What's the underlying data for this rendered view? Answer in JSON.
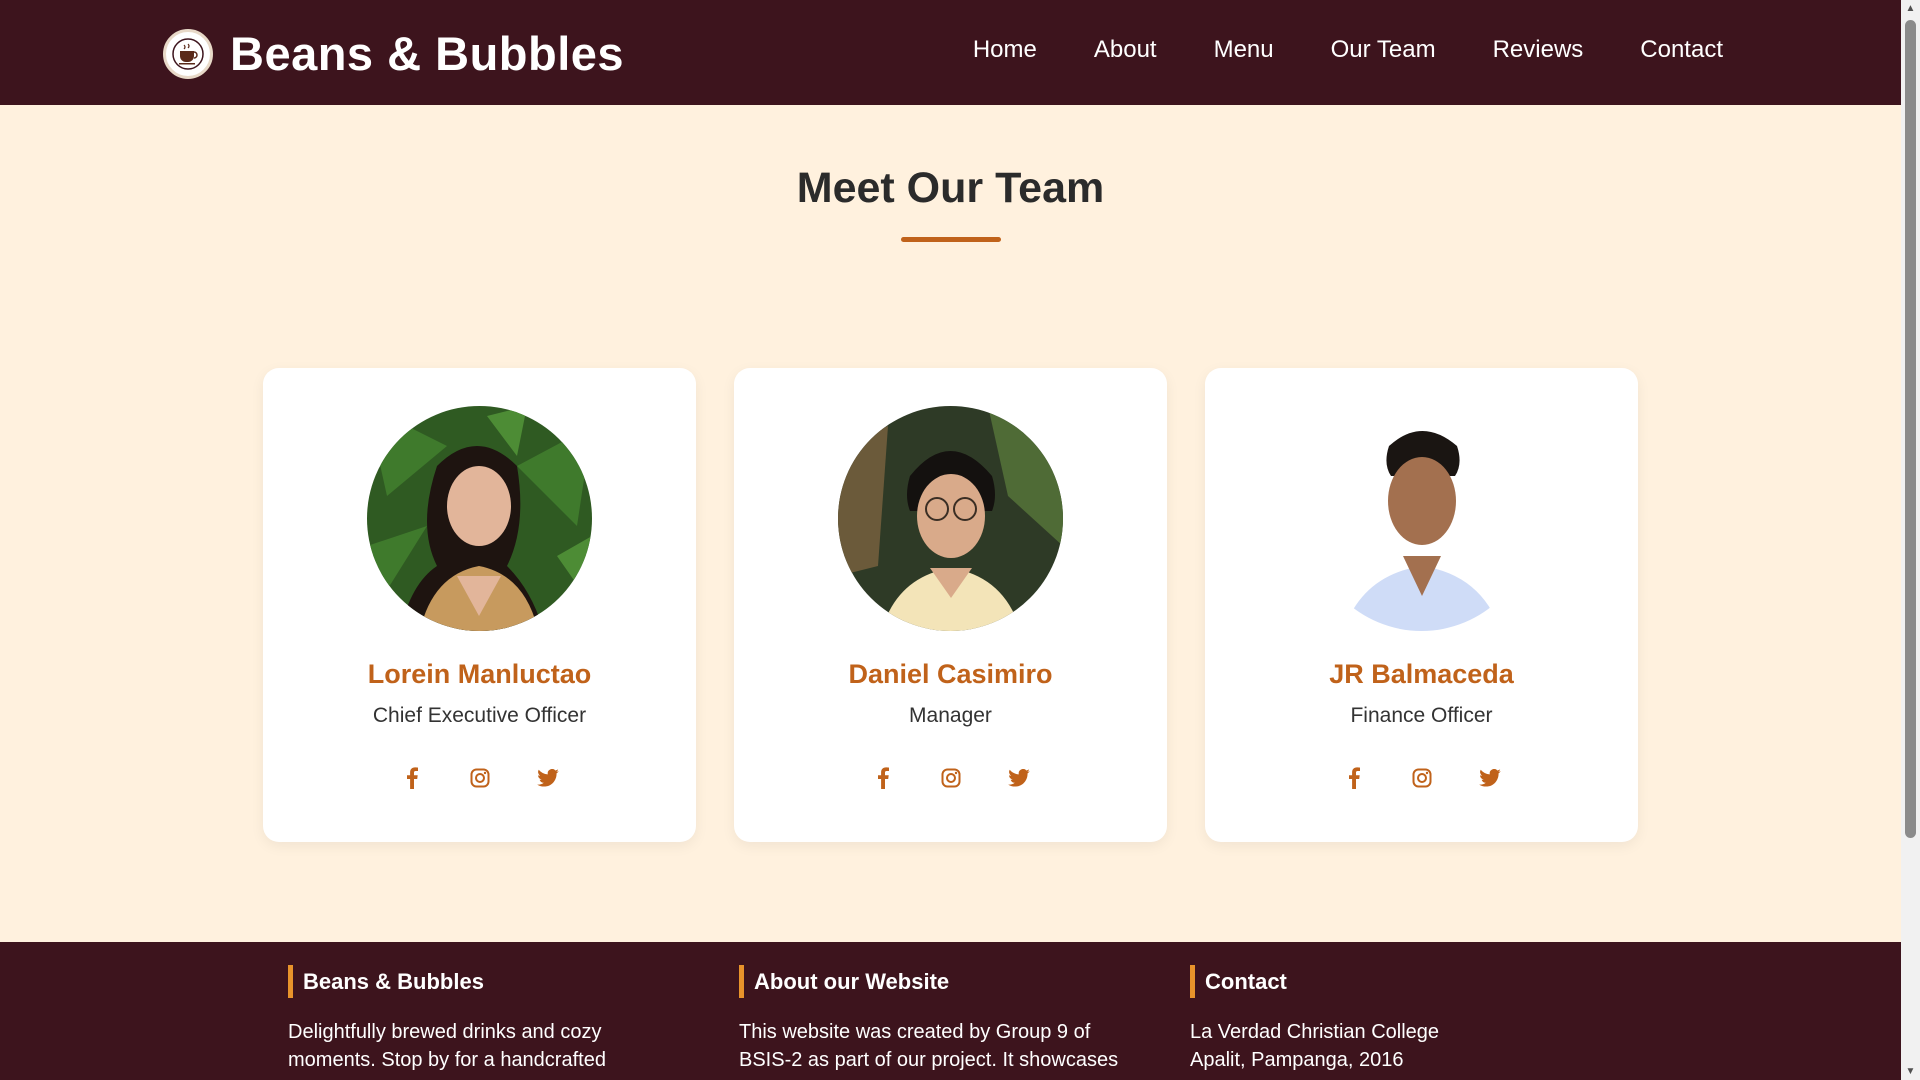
{
  "header": {
    "brand_title": "Beans & Bubbles",
    "nav": [
      "Home",
      "About",
      "Menu",
      "Our Team",
      "Reviews",
      "Contact"
    ]
  },
  "section": {
    "title": "Meet Our Team"
  },
  "team": [
    {
      "name": "Lorein Manluctao",
      "role": "Chief Executive Officer"
    },
    {
      "name": "Daniel Casimiro",
      "role": "Manager"
    },
    {
      "name": "JR Balmaceda",
      "role": "Finance Officer"
    }
  ],
  "footer": {
    "col1": {
      "title": "Beans & Bubbles",
      "lines": [
        "Delightfully brewed drinks and cozy",
        "moments. Stop by for a handcrafted"
      ]
    },
    "col2": {
      "title": "About our Website",
      "lines": [
        "This website was created by Group 9 of",
        "BSIS-2 as part of our project. It showcases"
      ]
    },
    "col3": {
      "title": "Contact",
      "lines": [
        "La Verdad Christian College",
        "Apalit, Pampanga, 2016"
      ]
    }
  },
  "colors": {
    "header_bg": "#3d141d",
    "page_bg": "#fff1de",
    "accent": "#c0621a",
    "footer_accent": "#e8932b"
  },
  "icons": [
    "coffee-cup-logo-icon",
    "facebook-icon",
    "instagram-icon",
    "twitter-icon"
  ]
}
